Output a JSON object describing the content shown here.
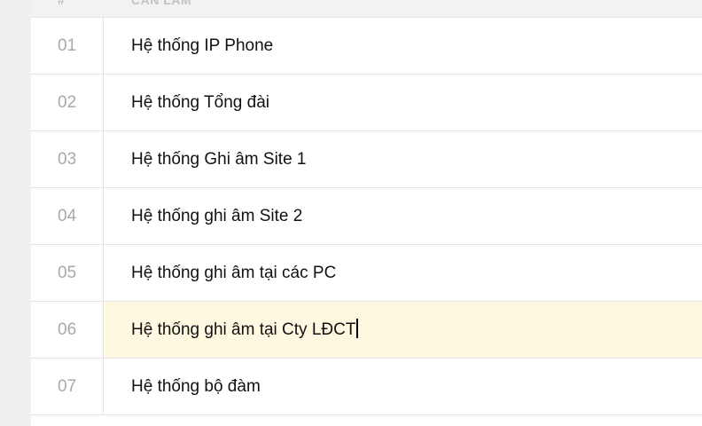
{
  "table": {
    "header": {
      "number_label": "#",
      "name_label": "CẦN LÀM"
    },
    "rows": [
      {
        "number": "01",
        "name": "Hệ thống IP Phone"
      },
      {
        "number": "02",
        "name": "Hệ thống Tổng đài"
      },
      {
        "number": "03",
        "name": "Hệ thống Ghi âm Site 1"
      },
      {
        "number": "04",
        "name": "Hệ thống ghi âm Site 2"
      },
      {
        "number": "05",
        "name": "Hệ thống ghi âm tại các PC"
      },
      {
        "number": "06",
        "name": "Hệ thống ghi âm tại Cty LĐCT"
      },
      {
        "number": "07",
        "name": "Hệ thống bộ đàm"
      }
    ],
    "highlighted_row": "06",
    "highlight_color": "#fff8e1"
  }
}
